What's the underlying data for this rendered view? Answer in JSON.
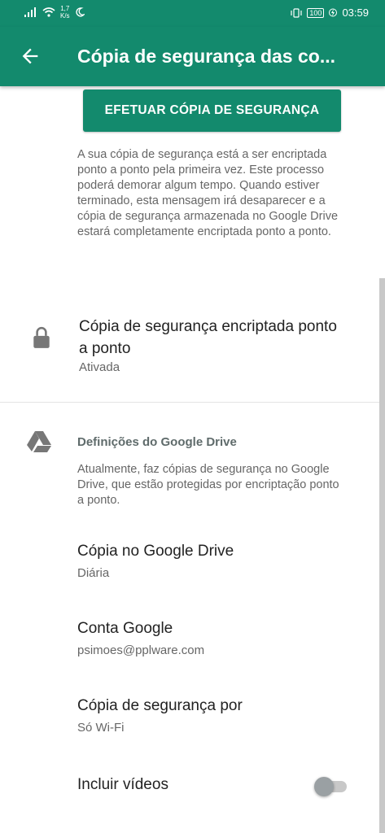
{
  "status_bar": {
    "speed_value": "1,7",
    "speed_unit": "K/s",
    "battery": "100",
    "time": "03:59"
  },
  "app_bar": {
    "title": "Cópia de segurança das co..."
  },
  "backup_button": {
    "label": "EFETUAR CÓPIA DE SEGURANÇA"
  },
  "info_text": "A sua cópia de segurança está a ser encriptada ponto a ponto pela primeira vez. Este processo poderá demorar algum tempo. Quando estiver terminado, esta mensagem irá desaparecer e a cópia de segurança armazenada no Google Drive estará completamente encriptada ponto a ponto.",
  "encrypted_backup": {
    "title": "Cópia de segurança encriptada ponto a ponto",
    "status": "Ativada"
  },
  "google_drive": {
    "header": "Definições do Google Drive",
    "description": "Atualmente, faz cópias de segurança no Google Drive, que estão protegidas por encriptação ponto a ponto.",
    "items": [
      {
        "label": "Cópia no Google Drive",
        "value": "Diária"
      },
      {
        "label": "Conta Google",
        "value": "psimoes@pplware.com"
      },
      {
        "label": "Cópia de segurança por",
        "value": "Só Wi-Fi"
      }
    ],
    "include_videos": {
      "label": "Incluir vídeos",
      "enabled": false
    }
  },
  "colors": {
    "primary": "#138a6d",
    "text_primary": "#222222",
    "text_secondary": "#666666"
  }
}
